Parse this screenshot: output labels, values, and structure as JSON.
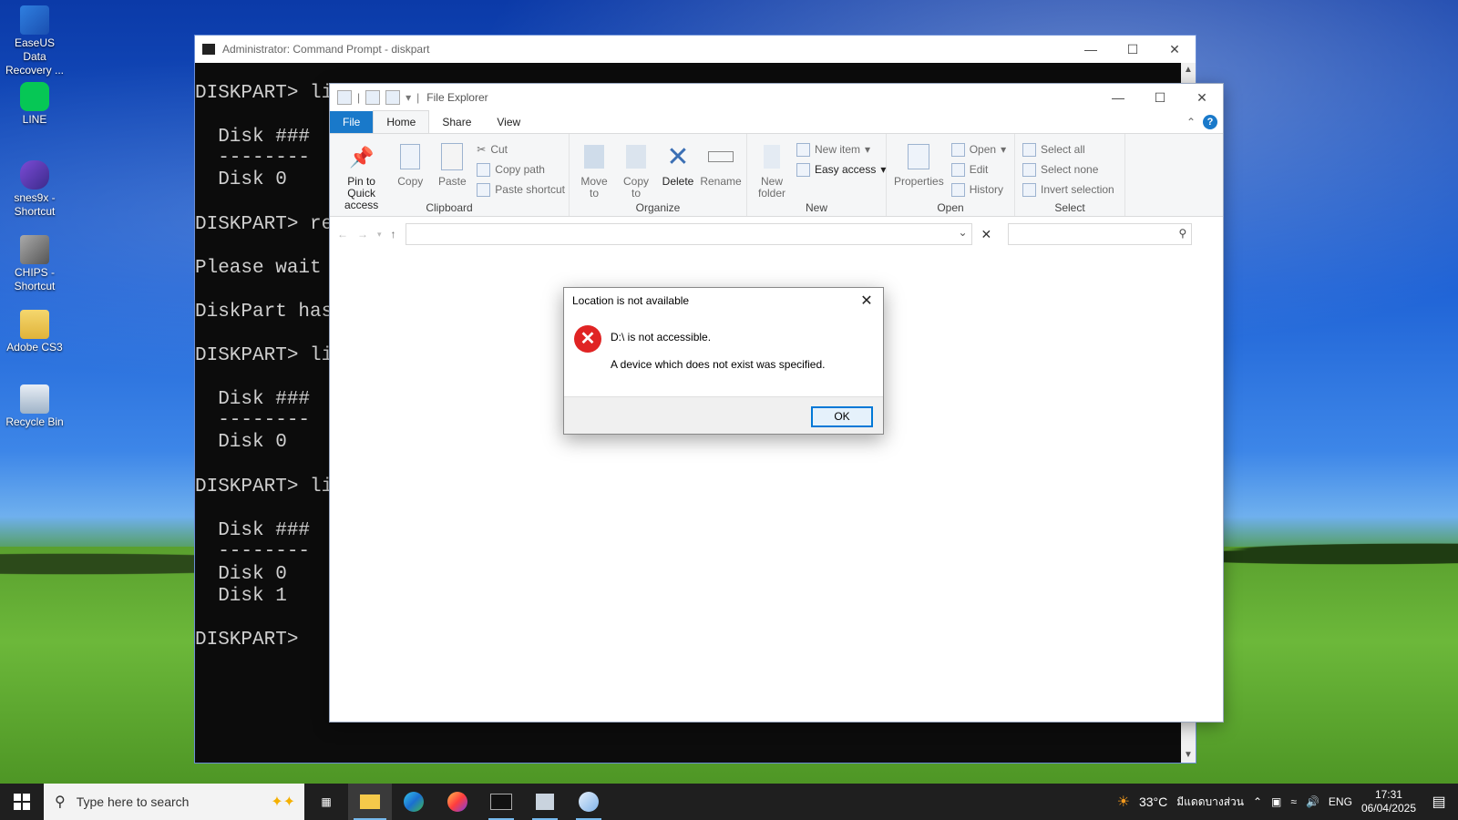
{
  "desktop": {
    "icons": [
      {
        "label": "EaseUS Data Recovery ..."
      },
      {
        "label": "LINE"
      },
      {
        "label": "snes9x - Shortcut"
      },
      {
        "label": "CHIPS - Shortcut"
      },
      {
        "label": "Adobe CS3"
      },
      {
        "label": "Recycle Bin"
      }
    ]
  },
  "cmd": {
    "title": "Administrator: Command Prompt - diskpart",
    "lines": [
      "DISKPART> li",
      "  Disk ###  S",
      "  --------  -",
      "  Disk 0    (",
      "DISKPART> re",
      "Please wait v",
      "DiskPart has",
      "DISKPART> li",
      "  Disk ###  S",
      "  --------  -",
      "  Disk 0    (",
      "DISKPART> li",
      "  Disk ###  S",
      "  --------  -",
      "  Disk 0    (",
      "  Disk 1    (",
      "DISKPART> "
    ]
  },
  "explorer": {
    "title": "File Explorer",
    "tabs": {
      "file": "File",
      "home": "Home",
      "share": "Share",
      "view": "View"
    },
    "ribbon": {
      "clipboard": {
        "label": "Clipboard",
        "pin": "Pin to Quick access",
        "copy": "Copy",
        "paste": "Paste",
        "cut": "Cut",
        "copy_path": "Copy path",
        "paste_shortcut": "Paste shortcut"
      },
      "organize": {
        "label": "Organize",
        "move_to": "Move to",
        "copy_to": "Copy to",
        "delete": "Delete",
        "rename": "Rename"
      },
      "new": {
        "label": "New",
        "new_folder": "New folder",
        "new_item": "New item",
        "easy_access": "Easy access"
      },
      "open": {
        "label": "Open",
        "properties": "Properties",
        "open": "Open",
        "edit": "Edit",
        "history": "History"
      },
      "select": {
        "label": "Select",
        "select_all": "Select all",
        "select_none": "Select none",
        "invert": "Invert selection"
      }
    },
    "help": "?"
  },
  "dialog": {
    "title": "Location is not available",
    "message": "D:\\ is not accessible.",
    "detail": "A device which does not exist was specified.",
    "ok": "OK"
  },
  "taskbar": {
    "search_placeholder": "Type here to search",
    "weather": "33°C",
    "weather_desc": "มีแดดบางส่วน",
    "lang": "ENG",
    "time": "17:31",
    "date": "06/04/2025"
  },
  "colors": {
    "accent": "#1979ca",
    "error": "#e02424"
  }
}
